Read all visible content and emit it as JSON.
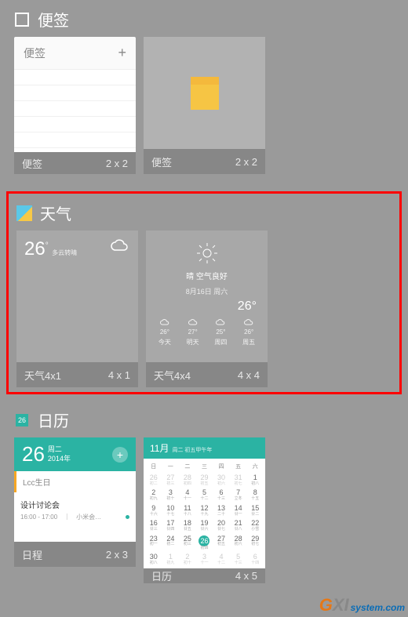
{
  "notes": {
    "title": "便签",
    "header": "便签",
    "plus": "+",
    "w1_label": "便签",
    "w1_size": "2 x 2",
    "w2_label": "便签",
    "w2_size": "2 x 2"
  },
  "weather": {
    "title": "天气",
    "small": {
      "temp": "26",
      "deg": "°",
      "sub": "多云转晴",
      "label": "天气4x1",
      "size": "4 x 1"
    },
    "large": {
      "cond": "晴 空气良好",
      "meta": "8月16日 周六",
      "temp": "26°",
      "label": "天气4x4",
      "size": "4 x 4",
      "forecast": [
        {
          "d": "今天",
          "t": "26°"
        },
        {
          "d": "明天",
          "t": "27°"
        },
        {
          "d": "周四",
          "t": "25°"
        },
        {
          "d": "周五",
          "t": "26°"
        }
      ]
    }
  },
  "calendar": {
    "title": "日历",
    "sched": {
      "date": "26",
      "day": "周二",
      "year": "2014年",
      "ev1": "Lcc生日",
      "ev2_title": "设计讨论会",
      "ev2_sub": "16:00 - 17:00　｜　小米会…",
      "label": "日程",
      "size": "2 x 3"
    },
    "full": {
      "month": "11月",
      "sub": "周二 初五甲午年",
      "label": "日历",
      "size": "4 x 5",
      "headers": [
        "日",
        "一",
        "二",
        "三",
        "四",
        "五",
        "六"
      ],
      "days": [
        {
          "n": "26",
          "l": "初二",
          "dim": 1
        },
        {
          "n": "27",
          "l": "初三",
          "dim": 1
        },
        {
          "n": "28",
          "l": "初四",
          "dim": 1
        },
        {
          "n": "29",
          "l": "初五",
          "dim": 1
        },
        {
          "n": "30",
          "l": "初六",
          "dim": 1
        },
        {
          "n": "31",
          "l": "初七",
          "dim": 1
        },
        {
          "n": "1",
          "l": "初八"
        },
        {
          "n": "2",
          "l": "初九"
        },
        {
          "n": "3",
          "l": "初十"
        },
        {
          "n": "4",
          "l": "十一"
        },
        {
          "n": "5",
          "l": "十二"
        },
        {
          "n": "6",
          "l": "十三"
        },
        {
          "n": "7",
          "l": "立冬"
        },
        {
          "n": "8",
          "l": "十五"
        },
        {
          "n": "9",
          "l": "十六"
        },
        {
          "n": "10",
          "l": "十七"
        },
        {
          "n": "11",
          "l": "十八"
        },
        {
          "n": "12",
          "l": "十九"
        },
        {
          "n": "13",
          "l": "二十"
        },
        {
          "n": "14",
          "l": "廿一"
        },
        {
          "n": "15",
          "l": "廿二"
        },
        {
          "n": "16",
          "l": "廿三"
        },
        {
          "n": "17",
          "l": "廿四"
        },
        {
          "n": "18",
          "l": "廿五"
        },
        {
          "n": "19",
          "l": "廿六"
        },
        {
          "n": "20",
          "l": "廿七"
        },
        {
          "n": "21",
          "l": "廿八"
        },
        {
          "n": "22",
          "l": "小雪"
        },
        {
          "n": "23",
          "l": "初一"
        },
        {
          "n": "24",
          "l": "初二"
        },
        {
          "n": "25",
          "l": "初三"
        },
        {
          "n": "26",
          "l": "初四",
          "today": 1
        },
        {
          "n": "27",
          "l": "初五"
        },
        {
          "n": "28",
          "l": "初六"
        },
        {
          "n": "29",
          "l": "初七"
        },
        {
          "n": "30",
          "l": "初八"
        },
        {
          "n": "1",
          "l": "初九",
          "dim": 1
        },
        {
          "n": "2",
          "l": "初十",
          "dim": 1
        },
        {
          "n": "3",
          "l": "十一",
          "dim": 1
        },
        {
          "n": "4",
          "l": "十二",
          "dim": 1
        },
        {
          "n": "5",
          "l": "十三",
          "dim": 1
        },
        {
          "n": "6",
          "l": "十四",
          "dim": 1
        }
      ]
    }
  },
  "watermark": {
    "g": "G",
    "xi": "XI",
    "dom": "system.com"
  }
}
